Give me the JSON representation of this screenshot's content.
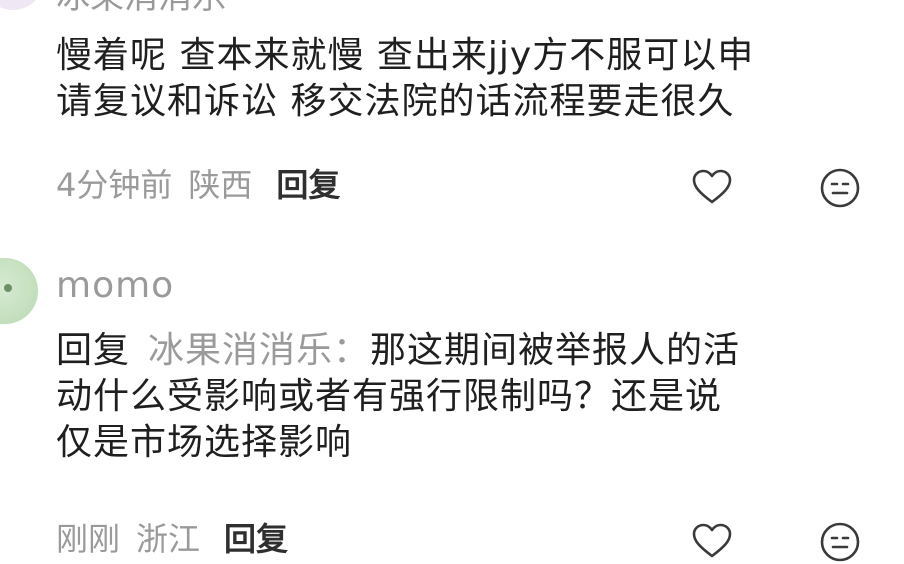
{
  "top_comment": {
    "username": "冰果消消乐",
    "text_lines": [
      "慢着呢 查本来就慢 查出来jjy方不服可以申",
      "请复议和诉讼 移交法院的话流程要走很久"
    ],
    "time": "4分钟前",
    "location": "陕西",
    "reply_label": "回复"
  },
  "reply_comment": {
    "username": "momo",
    "reply_prefix": "回复",
    "reply_to": "冰果消消乐：",
    "text_lines": [
      "那这期间被举报人的活",
      "动什么受影响或者有强行限制吗？还是说",
      "仅是市场选择影响"
    ],
    "time": "刚刚",
    "location": "浙江",
    "reply_label": "回复"
  },
  "icons": {
    "like": "heart-outline-icon",
    "emoji": "neutral-face-icon"
  },
  "colors": {
    "text": "#1f1f1f",
    "muted": "#9a9a9a",
    "avatar_green": "#c7e1c1"
  }
}
